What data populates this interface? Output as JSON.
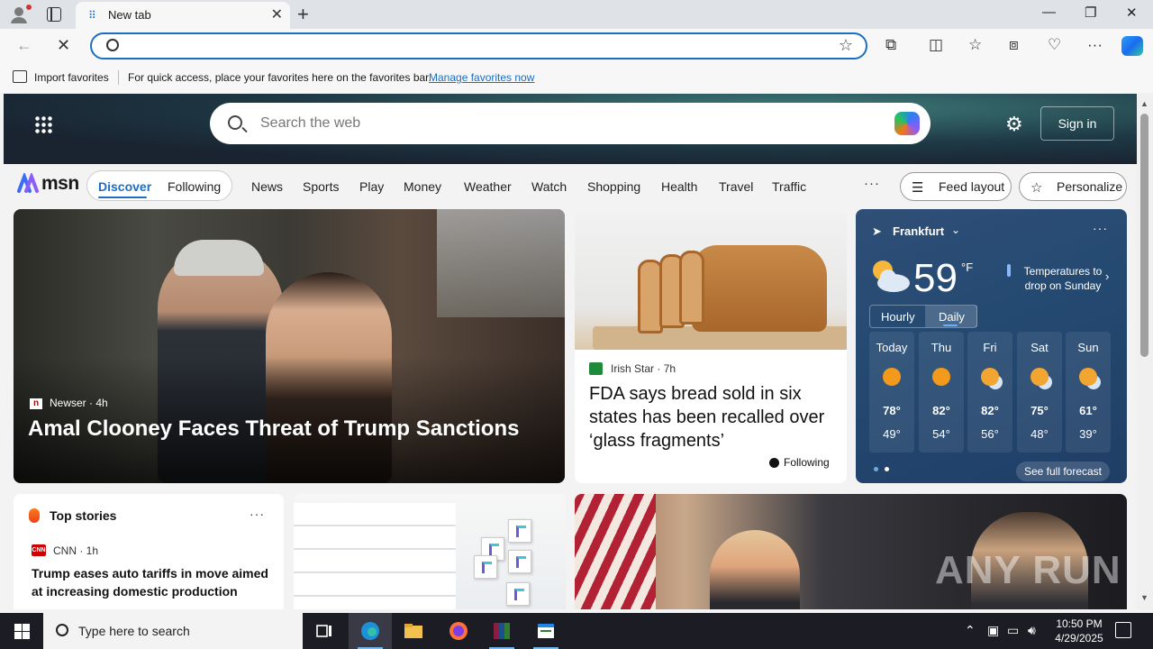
{
  "browser": {
    "tab_title": "New tab",
    "address_value": "",
    "favorites_bar": {
      "import_label": "Import favorites",
      "message": "For quick access, place your favorites here on the favorites bar.",
      "manage_link": "Manage favorites now"
    }
  },
  "msn": {
    "search_placeholder": "Search the web",
    "sign_in": "Sign in",
    "logo_text": "msn",
    "feed_tabs": [
      "Discover",
      "Following"
    ],
    "nav": [
      "News",
      "Sports",
      "Play",
      "Money",
      "Weather",
      "Watch",
      "Shopping",
      "Health",
      "Travel",
      "Traffic"
    ],
    "nav_more": "···",
    "feed_layout": "Feed layout",
    "personalize": "Personalize"
  },
  "main_story": {
    "source": "Newser",
    "age": "· 4h",
    "headline": "Amal Clooney Faces Threat of Trump Sanctions"
  },
  "bread_story": {
    "source": "Irish Star",
    "age": "· 7h",
    "headline": "FDA says bread sold in six states has been recalled over ‘glass fragments’",
    "following": "Following"
  },
  "weather": {
    "location": "Frankfurt",
    "temp": "59",
    "unit": "°F",
    "alert": "Temperatures to drop on Sunday",
    "tabs": [
      "Hourly",
      "Daily"
    ],
    "days": [
      {
        "name": "Today",
        "hi": "78°",
        "lo": "49°",
        "icon": "sun-icon"
      },
      {
        "name": "Thu",
        "hi": "82°",
        "lo": "54°",
        "icon": "sun-icon"
      },
      {
        "name": "Fri",
        "hi": "82°",
        "lo": "56°",
        "icon": "partly-cloudy-icon"
      },
      {
        "name": "Sat",
        "hi": "75°",
        "lo": "48°",
        "icon": "partly-cloudy-icon"
      },
      {
        "name": "Sun",
        "hi": "61°",
        "lo": "39°",
        "icon": "partly-cloudy-icon"
      }
    ],
    "see_forecast": "See full forecast"
  },
  "top_stories": {
    "title": "Top stories",
    "source": "CNN",
    "age": "· 1h",
    "headline": "Trump eases auto tariffs in move aimed at increasing domestic production"
  },
  "watermark": "ANY RUN",
  "taskbar": {
    "search_placeholder": "Type here to search",
    "time": "10:50 PM",
    "date": "4/29/2025"
  },
  "colors": {
    "accent": "#1b6ec2",
    "taskbar": "#1c1c24",
    "weather_bg": "#254a72"
  }
}
